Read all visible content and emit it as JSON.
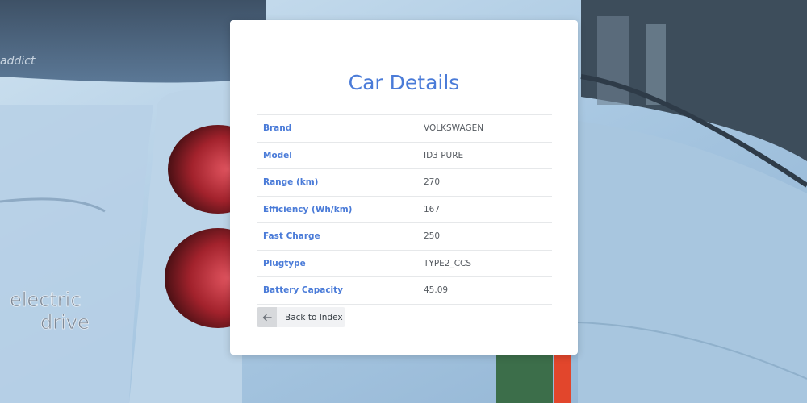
{
  "background": {
    "badge_text_top": "addict",
    "emblem_line1": "electric",
    "emblem_line2": "drive"
  },
  "card": {
    "title": "Car Details",
    "rows": [
      {
        "label": "Brand",
        "value": "VOLKSWAGEN"
      },
      {
        "label": "Model",
        "value": "ID3 PURE"
      },
      {
        "label": "Range (km)",
        "value": "270"
      },
      {
        "label": "Efficiency (Wh/km)",
        "value": "167"
      },
      {
        "label": "Fast Charge",
        "value": "250"
      },
      {
        "label": "Plugtype",
        "value": "TYPE2_CCS"
      },
      {
        "label": "Battery Capacity",
        "value": "45.09"
      }
    ],
    "back_button": {
      "label": "Back to Index",
      "icon": "arrow-left-icon"
    }
  },
  "colors": {
    "accent": "#4a7bd8",
    "value_text": "#555a60",
    "card_bg": "#ffffff"
  }
}
